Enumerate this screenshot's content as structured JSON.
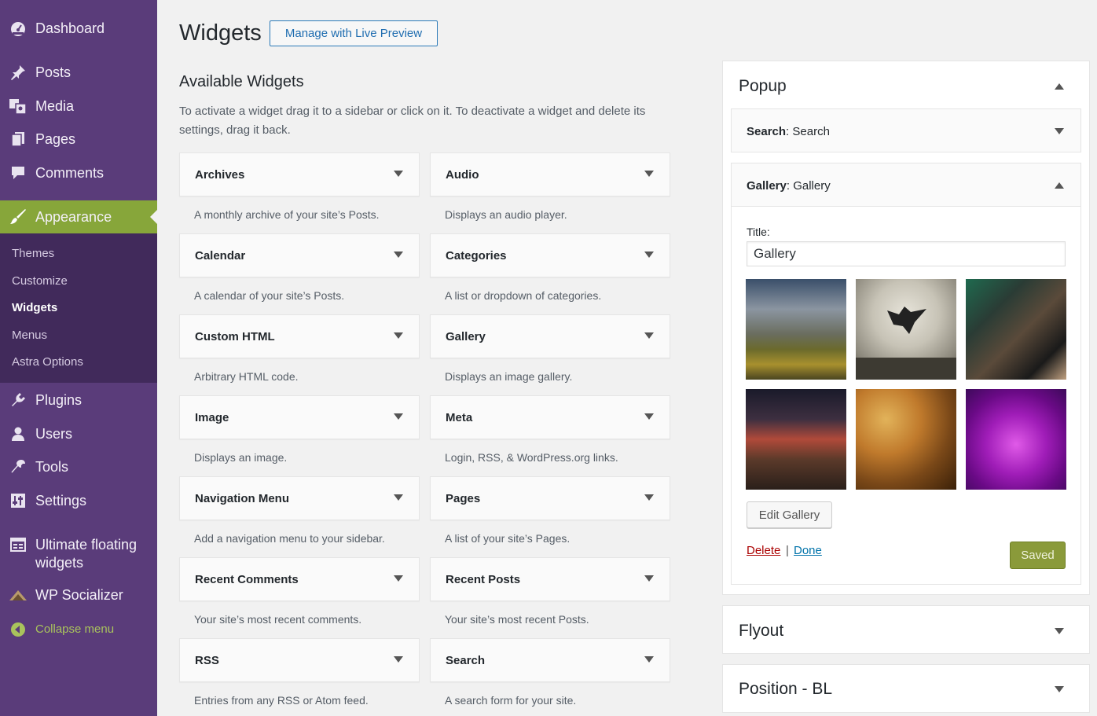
{
  "sidebar": {
    "items": [
      {
        "label": "Dashboard",
        "icon": "dashboard-icon"
      },
      {
        "label": "Posts",
        "icon": "pin-icon"
      },
      {
        "label": "Media",
        "icon": "media-icon"
      },
      {
        "label": "Pages",
        "icon": "pages-icon"
      },
      {
        "label": "Comments",
        "icon": "comment-icon"
      },
      {
        "label": "Appearance",
        "icon": "brush-icon"
      },
      {
        "label": "Plugins",
        "icon": "plug-icon"
      },
      {
        "label": "Users",
        "icon": "user-icon"
      },
      {
        "label": "Tools",
        "icon": "wrench-icon"
      },
      {
        "label": "Settings",
        "icon": "settings-icon"
      },
      {
        "label": "Ultimate floating",
        "label2": "widgets",
        "icon": "grid-icon"
      },
      {
        "label": "WP Socializer",
        "icon": "bridge-icon"
      },
      {
        "label": "Collapse menu",
        "icon": "collapse-icon"
      }
    ],
    "submenu": [
      "Themes",
      "Customize",
      "Widgets",
      "Menus",
      "Astra Options"
    ]
  },
  "header": {
    "title": "Widgets",
    "live_preview": "Manage with Live Preview"
  },
  "available": {
    "title": "Available Widgets",
    "description": "To activate a widget drag it to a sidebar or click on it. To deactivate a widget and delete its settings, drag it back.",
    "widgets": [
      {
        "title": "Archives",
        "desc": "A monthly archive of your site’s Posts."
      },
      {
        "title": "Audio",
        "desc": "Displays an audio player."
      },
      {
        "title": "Calendar",
        "desc": "A calendar of your site’s Posts."
      },
      {
        "title": "Categories",
        "desc": "A list or dropdown of categories."
      },
      {
        "title": "Custom HTML",
        "desc": "Arbitrary HTML code."
      },
      {
        "title": "Gallery",
        "desc": "Displays an image gallery."
      },
      {
        "title": "Image",
        "desc": "Displays an image."
      },
      {
        "title": "Meta",
        "desc": "Login, RSS, & WordPress.org links."
      },
      {
        "title": "Navigation Menu",
        "desc": "Add a navigation menu to your sidebar."
      },
      {
        "title": "Pages",
        "desc": "A list of your site’s Pages."
      },
      {
        "title": "Recent Comments",
        "desc": "Your site’s most recent comments."
      },
      {
        "title": "Recent Posts",
        "desc": "Your site’s most recent Posts."
      },
      {
        "title": "RSS",
        "desc": "Entries from any RSS or Atom feed."
      },
      {
        "title": "Search",
        "desc": "A search form for your site."
      }
    ]
  },
  "areas": {
    "popup": {
      "title": "Popup",
      "search_widget": {
        "type": "Search",
        "name": "Search"
      },
      "gallery_widget": {
        "type": "Gallery",
        "name": "Gallery",
        "title_label": "Title:",
        "title_value": "Gallery",
        "edit_label": "Edit Gallery",
        "delete_label": "Delete",
        "separator": "|",
        "done_label": "Done",
        "saved_label": "Saved"
      }
    },
    "flyout": {
      "title": "Flyout"
    },
    "position_bl": {
      "title": "Position - BL"
    }
  },
  "colors": {
    "sidebar_bg": "#5a3c7a",
    "submenu_bg": "#412a5b",
    "active": "#87a63a",
    "saved_btn": "#8a9a3a",
    "link": "#0073aa",
    "delete": "#aa0000"
  }
}
